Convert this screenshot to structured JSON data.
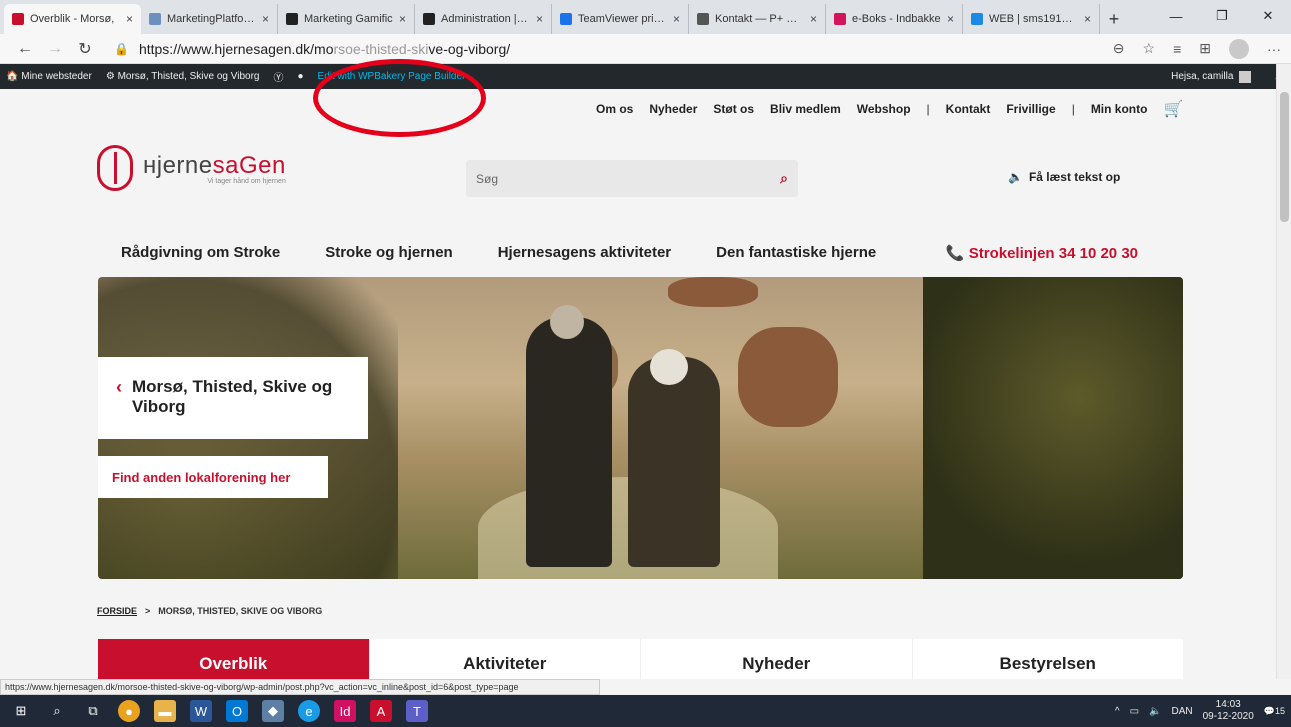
{
  "browser": {
    "tabs": [
      {
        "title": "Overblik - Morsø,",
        "color": "#c8102e",
        "active": true
      },
      {
        "title": "MarketingPlatform",
        "color": "#6b8fbf",
        "active": false
      },
      {
        "title": "Marketing Gamific",
        "color": "#222222",
        "active": false
      },
      {
        "title": "Administration | Le",
        "color": "#222222",
        "active": false
      },
      {
        "title": "TeamViewer pris: F",
        "color": "#1a73e8",
        "active": false
      },
      {
        "title": "Kontakt — P+ Pen",
        "color": "#555555",
        "active": false
      },
      {
        "title": "e-Boks - Indbakke",
        "color": "#d4145a",
        "active": false
      },
      {
        "title": "WEB | sms1919.dk",
        "color": "#1e88e5",
        "active": false
      }
    ],
    "url": "https://www.hjernesagen.dk/morsoe-thisted-skive-og-viborg/",
    "url_display_a": "https://www.hjernesagen.dk/mo",
    "url_display_b": "ve-og-viborg/",
    "status_url": "https://www.hjernesagen.dk/morsoe-thisted-skive-og-viborg/wp-admin/post.php?vc_action=vc_inline&post_id=6&post_type=page"
  },
  "wpbar": {
    "my_sites": "Mine websteder",
    "site": "Morsø, Thisted, Skive og Viborg",
    "edit": "Edit with WPBakery Page Builder",
    "greeting": "Hejsa, camilla"
  },
  "topnav": [
    "Om os",
    "Nyheder",
    "Støt os",
    "Bliv medlem",
    "Webshop",
    "Kontakt",
    "Frivillige",
    "Min konto"
  ],
  "logo": {
    "name_a": "нjerne",
    "name_b": "saGen",
    "tagline": "Vi tager hånd om hjernen"
  },
  "search": {
    "placeholder": "Søg"
  },
  "listen": "Få læst tekst op",
  "mainnav": [
    "Rådgivning om Stroke",
    "Stroke og hjernen",
    "Hjernesagens aktiviteter",
    "Den fantastiske hjerne"
  ],
  "phone": "Strokelinjen 34 10 20 30",
  "location_title": "Morsø, Thisted, Skive og Viborg",
  "find_link": "Find anden lokalforening her",
  "breadcrumb": {
    "home": "FORSIDE",
    "sep": ">",
    "current": "MORSØ, THISTED, SKIVE OG VIBORG"
  },
  "page_tabs": [
    "Overblik",
    "Aktiviteter",
    "Nyheder",
    "Bestyrelsen"
  ],
  "taskbar": {
    "lang": "DAN",
    "time": "14:03",
    "date": "09-12-2020",
    "notif": "15"
  }
}
